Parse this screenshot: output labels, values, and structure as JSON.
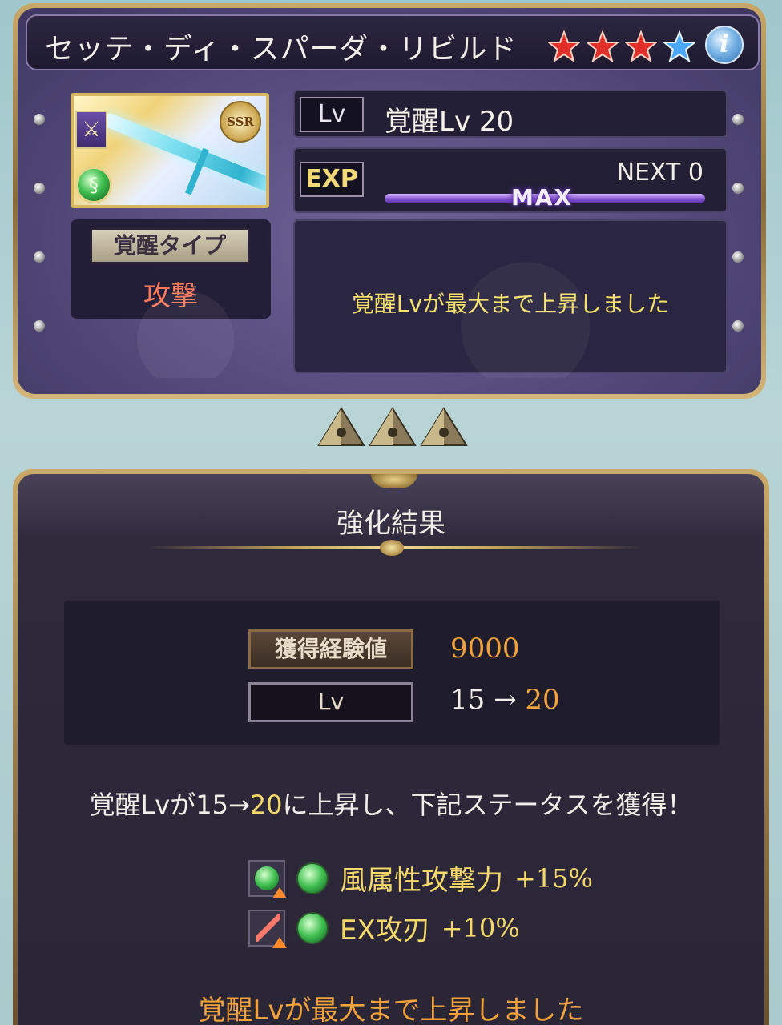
{
  "weapon": {
    "name": "セッテ・ディ・スパーダ・リビルド",
    "rarity_badge": "SSR",
    "type_icon": "sword-icon",
    "element_icon": "wind-icon",
    "stars": {
      "filled": 3,
      "total": 4,
      "filled_color": "#e0302a",
      "partial_color": "#4aa8ff"
    },
    "info_label": "i"
  },
  "level": {
    "tag": "Lv",
    "text": "覚醒Lv 20"
  },
  "exp": {
    "tag": "EXP",
    "next_text": "NEXT 0",
    "max_label": "MAX",
    "progress": 1.0
  },
  "awaken": {
    "label": "覚醒タイプ",
    "value": "攻撃"
  },
  "top_message": "覚醒Lvが最大まで上昇しました",
  "result": {
    "title": "強化結果",
    "exp_label": "獲得経験値",
    "exp_value": "9000",
    "lv_label": "Lv",
    "lv_from": "15 →",
    "lv_to": "20"
  },
  "gain": {
    "prefix": "覚醒Lvが15→",
    "highlight": "20",
    "suffix": "に上昇し、下記ステータスを獲得！"
  },
  "skills": [
    {
      "icon": "wind-attack-up-icon",
      "element_icon": "wind-icon",
      "name": "風属性攻撃力",
      "value": "+15%"
    },
    {
      "icon": "ex-blade-up-icon",
      "element_icon": "wind-icon",
      "name": "EX攻刃",
      "value": "+10%"
    }
  ],
  "footer_message": "覚醒Lvが最大まで上昇しました",
  "colors": {
    "accent_gold": "#f4d96a",
    "accent_orange": "#f2a23a",
    "awaken_value": "#ff7a5a",
    "panel_purple": "#544a7c"
  }
}
